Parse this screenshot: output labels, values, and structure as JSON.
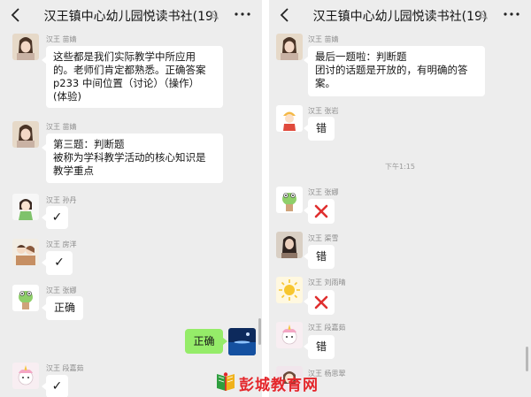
{
  "left": {
    "header": {
      "title": "汉王镇中心幼儿园悦读书社(19)",
      "back_icon": "chevron-left-icon",
      "mute_icon": "bell-muted-icon",
      "more_icon": "more-dots-icon"
    },
    "messages": [
      {
        "sender": "汉王 苗婧",
        "lines": [
          "这些都是我们实际教学中所应用",
          "的。老师们肯定都熟悉。正确答案",
          "p233 中间位置（讨论）（操作）",
          "(体验)"
        ]
      },
      {
        "sender": "汉王 苗婧",
        "lines": [
          "第三题：判断题",
          "被称为学科教学活动的核心知识是",
          "教学重点"
        ]
      },
      {
        "sender": "汉王 孙丹",
        "text": "✓"
      },
      {
        "sender": "汉王 房洋",
        "text": "✓"
      },
      {
        "sender": "汉王 张娜",
        "text": "正确"
      },
      {
        "sender": "",
        "text": "正确",
        "self": true
      },
      {
        "sender": "汉王 段嘉茹",
        "text": "✓"
      }
    ]
  },
  "right": {
    "header": {
      "title": "汉王镇中心幼儿园悦读书社(19)",
      "back_icon": "chevron-left-icon",
      "mute_icon": "bell-muted-icon",
      "more_icon": "more-dots-icon"
    },
    "messages": [
      {
        "sender": "汉王 苗婧",
        "lines": [
          "最后一题啦：判断题",
          "团讨的话题是开放的，有明确的答",
          "案。"
        ]
      },
      {
        "sender": "汉王 张岩",
        "text": "错"
      },
      {
        "sender": "汉王 张娜",
        "text": "✗"
      },
      {
        "sender": "汉王 渠雪",
        "text": "错"
      },
      {
        "sender": "汉王 刘雨晴",
        "text": "✗"
      },
      {
        "sender": "汉王 段嘉茹",
        "text": "错"
      },
      {
        "sender": "汉王 杨思翠",
        "text": ""
      }
    ],
    "time_separator": "下午1:15"
  },
  "watermark": {
    "text": "彭城教育网"
  },
  "colors": {
    "background": "#ededed",
    "bubble": "#ffffff",
    "self_bubble": "#95ec69",
    "sender": "#8c8c8c",
    "cross": "#e02f2f",
    "watermark": "#e4262b"
  }
}
